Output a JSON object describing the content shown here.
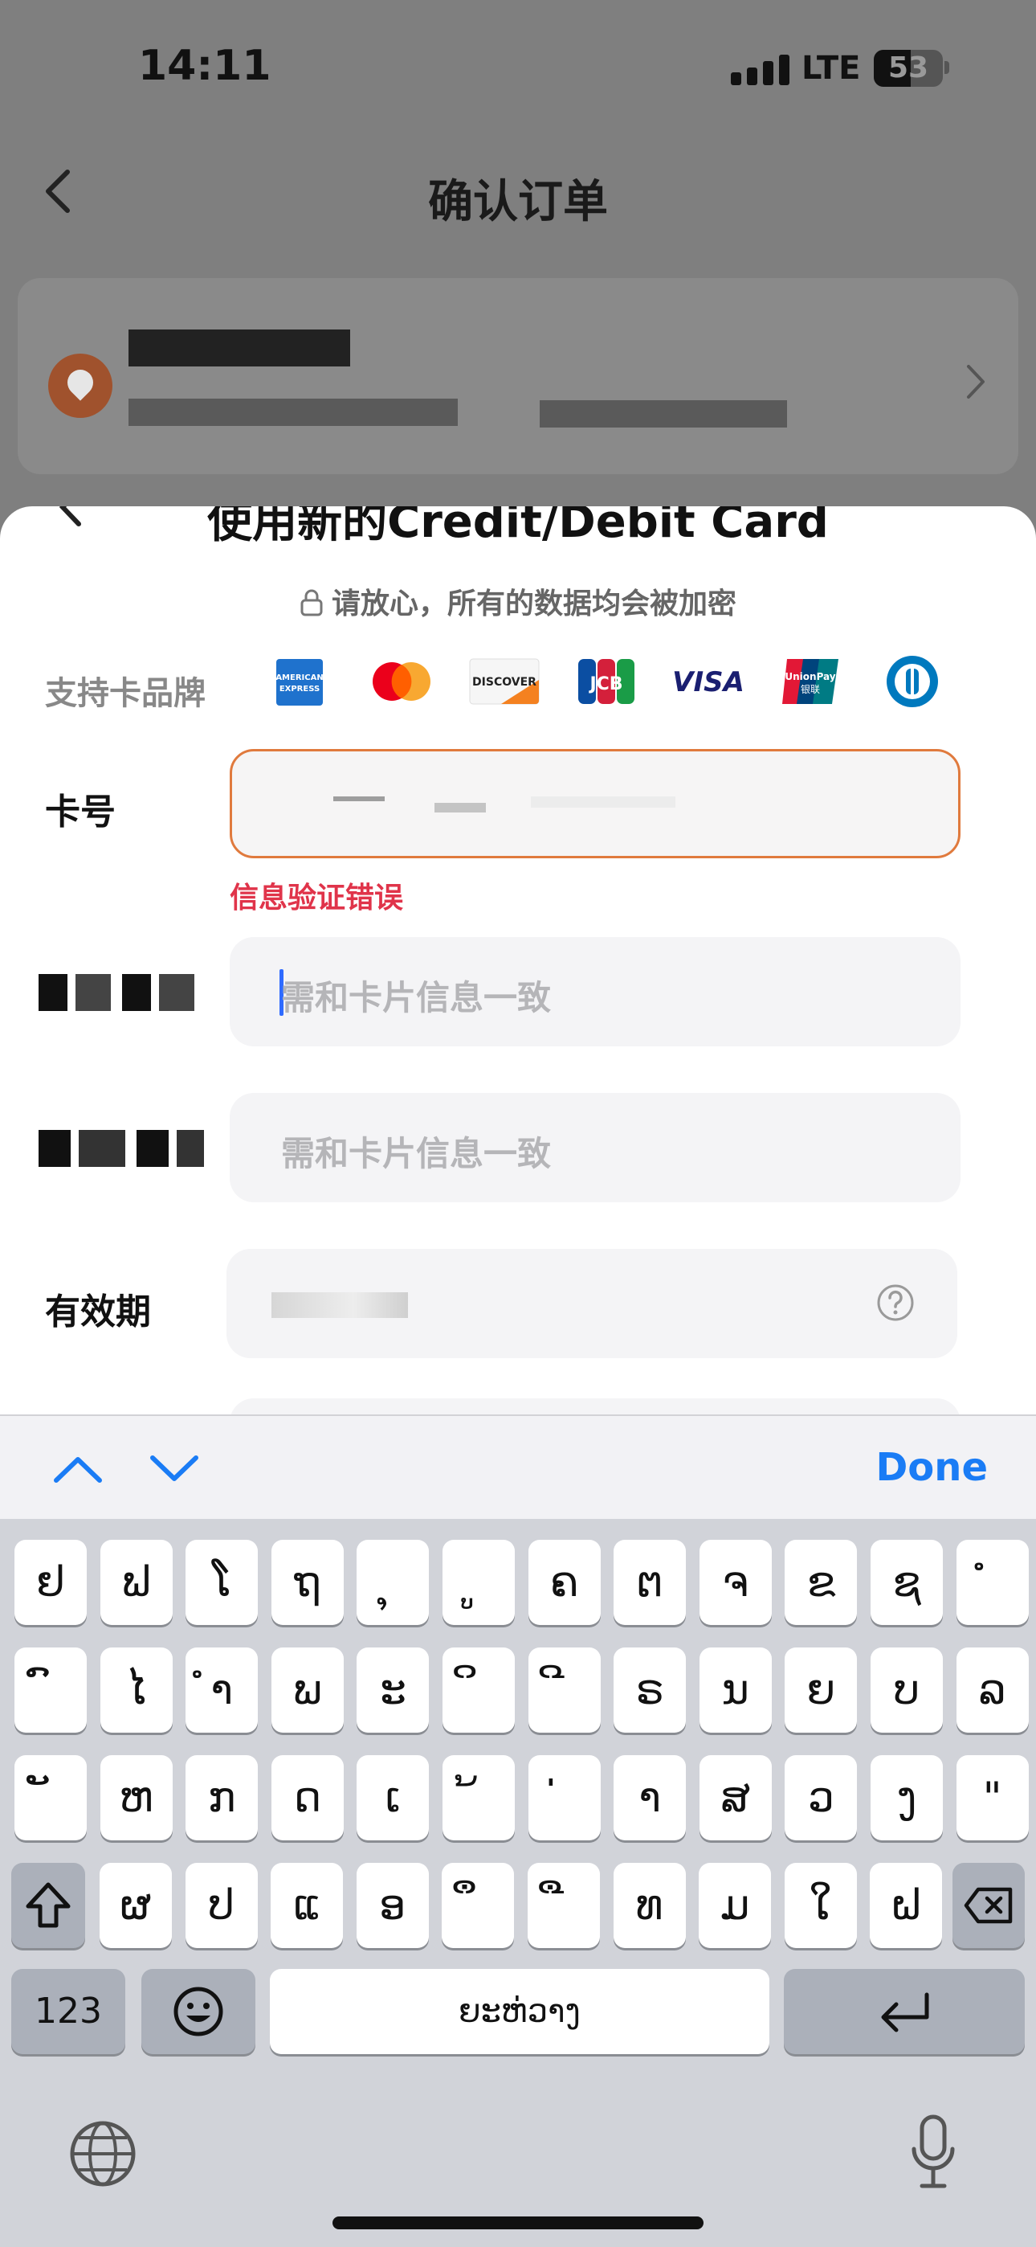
{
  "status_bar": {
    "time": "14:11",
    "network": "LTE",
    "battery": "53"
  },
  "header": {
    "title": "确认订单"
  },
  "sheet": {
    "title": "使用新的Credit/Debit Card",
    "secure_note": "请放心，所有的数据均会被加密",
    "brands_label": "支持卡品牌",
    "brands": [
      "American Express",
      "Mastercard",
      "Discover",
      "JCB",
      "VISA",
      "UnionPay",
      "Diners Club"
    ],
    "card_number_label": "卡号",
    "card_number_error": "信息验证错误",
    "first_name_placeholder": "需和卡片信息一致",
    "last_name_placeholder": "需和卡片信息一致",
    "expiry_label": "有效期"
  },
  "toolbar": {
    "done_label": "Done"
  },
  "keyboard": {
    "row1": [
      "ຢ",
      "ຟ",
      "ໂ",
      "ຖ",
      "ຸ",
      "ູ",
      "ຄ",
      "ຕ",
      "ຈ",
      "ຂ",
      "ຊ",
      "ໍ"
    ],
    "row2": [
      "ົ",
      "ໄ",
      "ຳ",
      "ພ",
      "ະ",
      "ິ",
      "ີ",
      "ຣ",
      "ນ",
      "ຍ",
      "ບ",
      "ລ"
    ],
    "row3": [
      "ັ",
      "ຫ",
      "ກ",
      "ດ",
      "ເ",
      "້",
      "່",
      "າ",
      "ສ",
      "ວ",
      "ງ",
      "\""
    ],
    "row4": [
      "ຜ",
      "ປ",
      "ແ",
      "ອ",
      "ຶ",
      "ື",
      "ທ",
      "ມ",
      "ໃ",
      "ຝ"
    ],
    "numbers_label": "123",
    "space_label": "ຍະຫ່ວາງ"
  },
  "colors": {
    "accent": "#1a7cf5",
    "error": "#e0344a",
    "error_border": "#e07a3d"
  }
}
